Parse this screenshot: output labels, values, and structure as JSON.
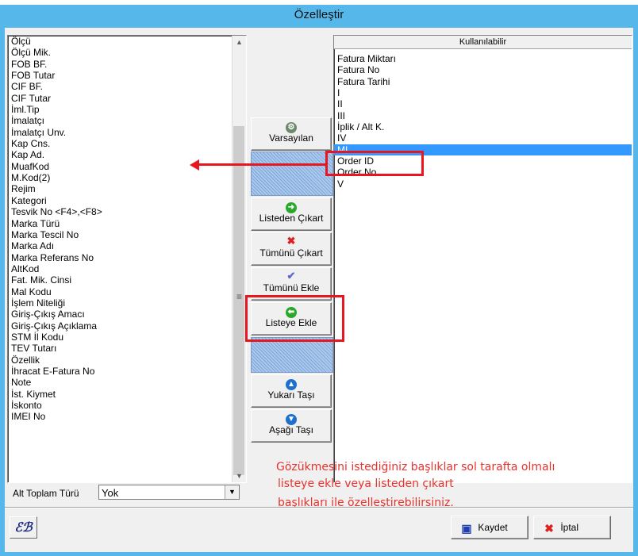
{
  "window": {
    "title": "Özelleştir"
  },
  "left_list": {
    "items": [
      "Ölçü",
      "Ölçü Mik.",
      "FOB BF.",
      "FOB Tutar",
      "CIF BF.",
      "CIF Tutar",
      "İml.Tip",
      "İmalatçı",
      "İmalatçı Unv.",
      "Kap Cns.",
      "Kap Ad.",
      "MuafKod",
      "M.Kod(2)",
      "Rejim",
      "Kategori",
      "Tesvik No <F4>,<F8>",
      "Marka Türü",
      "Marka Tescil No",
      "Marka Adı",
      "Marka Referans No",
      "AltKod",
      "Fat. Mik. Cinsi",
      "Mal Kodu",
      "İşlem Niteliği",
      "Giriş-Çıkış Amacı",
      "Giriş-Çıkış Açıklama",
      "STM İl Kodu",
      "TEV Tutarı",
      "Özellik",
      "İhracat E-Fatura No",
      "Note",
      "İst. Kiymet",
      "İskonto",
      "IMEI No"
    ]
  },
  "right_list": {
    "header": "Kullanılabilir",
    "items": [
      "Fatura Miktarı",
      "Fatura No",
      "Fatura Tarihi",
      "I",
      "II",
      "III",
      "İplik / Alt K.",
      "IV",
      "MI",
      "Order ID",
      "Order No",
      "V"
    ],
    "selected": "MI"
  },
  "buttons": {
    "defaults": "Varsayılan",
    "remove_from_list": "Listeden Çıkart",
    "remove_all": "Tümünü Çıkart",
    "add_all": "Tümünü Ekle",
    "add_to_list": "Listeye Ekle",
    "move_up": "Yukarı Taşı",
    "move_down": "Aşağı Taşı"
  },
  "subtotal": {
    "label": "Alt Toplam Türü",
    "value": "Yok"
  },
  "footer": {
    "save": "Kaydet",
    "cancel": "İptal",
    "logo": "EB"
  },
  "annotation": {
    "lines": [
      "Gözükmesini istediğiniz başlıklar sol tarafta olmalı",
      "listeye ekle veya listeden çıkart",
      "başlıkları ile özelleştirebilirsiniz."
    ]
  },
  "colors": {
    "annotation_red": "#e8161e",
    "selection_blue": "#3399ff",
    "title_bar": "#56b8ea"
  },
  "icons": {
    "defaults": "gear-icon",
    "remove_from_list": "arrow-right-icon",
    "remove_all": "x-icon",
    "add_all": "checkmark-icon",
    "add_to_list": "arrow-left-icon",
    "move_up": "arrow-up-icon",
    "move_down": "arrow-down-icon",
    "save": "save-icon",
    "cancel": "x-icon"
  }
}
